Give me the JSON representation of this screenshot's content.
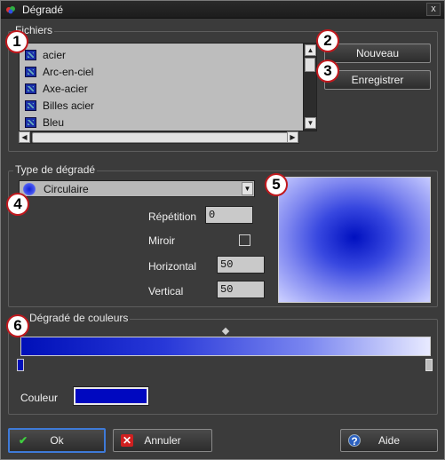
{
  "window": {
    "title": "Dégradé",
    "close_label": "x"
  },
  "files": {
    "group_label": "Fichiers",
    "items": [
      {
        "label": "acier"
      },
      {
        "label": "Arc-en-ciel"
      },
      {
        "label": "Axe-acier"
      },
      {
        "label": "Billes acier"
      },
      {
        "label": "Bleu"
      }
    ],
    "new_button": "Nouveau",
    "save_button": "Enregistrer"
  },
  "gradient_type": {
    "group_label": "Type de dégradé",
    "selected": "Circulaire",
    "repetition_label": "Répétition",
    "repetition_value": "0",
    "mirror_label": "Miroir",
    "mirror_checked": false,
    "horizontal_label": "Horizontal",
    "horizontal_value": "50",
    "vertical_label": "Vertical",
    "vertical_value": "50"
  },
  "color_gradient": {
    "group_label": "Dégradé de couleurs",
    "start_color": "#0010b8",
    "end_color": "#e8eaff",
    "color_label": "Couleur",
    "selected_color": "#0008c0"
  },
  "callouts": [
    "1",
    "2",
    "3",
    "4",
    "5",
    "6"
  ],
  "footer": {
    "ok_label": "Ok",
    "cancel_label": "Annuler",
    "help_label": "Aide"
  },
  "icons": {
    "title": "gradient-app-icon",
    "ok": "checkmark-icon",
    "cancel": "cross-icon",
    "help": "question-icon"
  }
}
